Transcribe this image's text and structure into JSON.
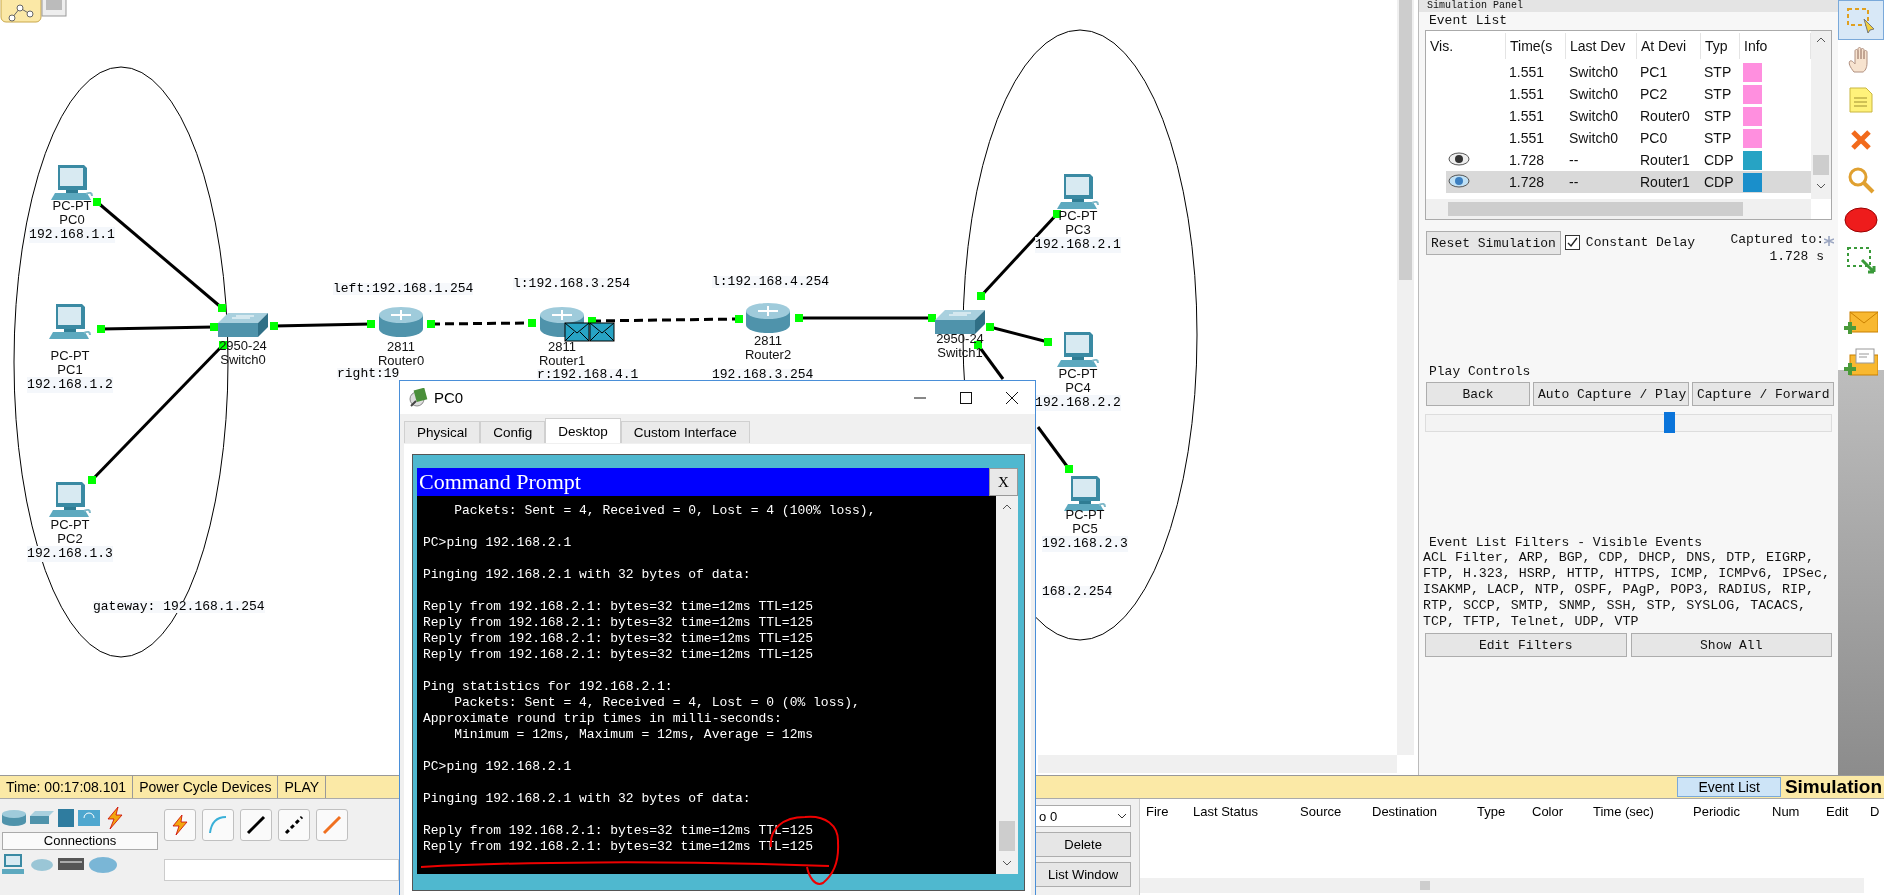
{
  "canvas": {
    "devices": [
      {
        "kind": "pc",
        "model": "PC-PT",
        "name": "PC0",
        "ip": "192.168.1.1"
      },
      {
        "kind": "pc",
        "model": "PC-PT",
        "name": "PC1",
        "ip": "192.168.1.2"
      },
      {
        "kind": "pc",
        "model": "PC-PT",
        "name": "PC2",
        "ip": "192.168.1.3"
      },
      {
        "kind": "switch",
        "model": "2950-24",
        "name": "Switch0"
      },
      {
        "kind": "router",
        "model": "2811",
        "name": "Router0"
      },
      {
        "kind": "router",
        "model": "2811",
        "name": "Router1"
      },
      {
        "kind": "router",
        "model": "2811",
        "name": "Router2"
      },
      {
        "kind": "switch",
        "model": "2950-24",
        "name": "Switch1"
      },
      {
        "kind": "pc",
        "model": "PC-PT",
        "name": "PC3",
        "ip": "192.168.2.1"
      },
      {
        "kind": "pc",
        "model": "PC-PT",
        "name": "PC4",
        "ip": "192.168.2.2"
      },
      {
        "kind": "pc",
        "model": "PC-PT",
        "name": "PC5",
        "ip": "192.168.2.3"
      }
    ],
    "notes": [
      "left:192.168.1.254",
      "right:19",
      "l:192.168.3.254",
      "r:192.168.4.1",
      "l:192.168.4.254",
      "192.168.3.254",
      "168.2.254",
      "gateway: 192.168.1.254"
    ]
  },
  "simulation_panel": {
    "title": "Simulation Panel",
    "event_list": {
      "label": "Event List",
      "columns": [
        "Vis.",
        "Time(s",
        "Last Dev",
        "At Devi",
        "Typ",
        "Info"
      ],
      "rows": [
        {
          "visible": false,
          "selected": false,
          "time": "1.551",
          "last_device": "Switch0",
          "at_device": "PC1",
          "type": "STP",
          "color": "#ff8fdf"
        },
        {
          "visible": false,
          "selected": false,
          "time": "1.551",
          "last_device": "Switch0",
          "at_device": "PC2",
          "type": "STP",
          "color": "#ff8fdf"
        },
        {
          "visible": false,
          "selected": false,
          "time": "1.551",
          "last_device": "Switch0",
          "at_device": "Router0",
          "type": "STP",
          "color": "#ff8fdf"
        },
        {
          "visible": false,
          "selected": false,
          "time": "1.551",
          "last_device": "Switch0",
          "at_device": "PC0",
          "type": "STP",
          "color": "#ff8fdf"
        },
        {
          "visible": true,
          "selected": false,
          "time": "1.728",
          "last_device": "--",
          "at_device": "Router1",
          "type": "CDP",
          "color": "#27a3c4"
        },
        {
          "visible": true,
          "selected": true,
          "time": "1.728",
          "last_device": "--",
          "at_device": "Router1",
          "type": "CDP",
          "color": "#1a8fcb"
        }
      ]
    },
    "reset": "Reset Simulation",
    "constant_delay": {
      "label": "Constant Delay",
      "checked": true
    },
    "captured_label": "Captured to:",
    "captured_value": "1.728 s",
    "play_controls": {
      "label": "Play Controls",
      "buttons": [
        "Back",
        "Auto Capture / Play",
        "Capture / Forward"
      ],
      "level": 0.6
    },
    "filters": {
      "label": "Event List Filters - Visible Events",
      "text": "ACL Filter, ARP, BGP, CDP, DHCP, DNS, DTP, EIGRP, FTP, H.323, HSRP, HTTP, HTTPS, ICMP, ICMPv6, IPSec, ISAKMP, LACP, NTP, OSPF, PAgP, POP3, RADIUS, RIP, RTP, SCCP, SMTP, SNMP, SSH, STP, SYSLOG, TACACS, TCP, TFTP, Telnet, UDP, VTP",
      "buttons": [
        "Edit Filters",
        "Show All"
      ]
    }
  },
  "tools": [
    {
      "kind": "select",
      "selected": true
    },
    {
      "kind": "hand",
      "selected": false
    },
    {
      "kind": "note",
      "selected": false
    },
    {
      "kind": "delete",
      "selected": false
    },
    {
      "kind": "inspect",
      "selected": false
    },
    {
      "kind": "ellipse",
      "selected": false
    },
    {
      "kind": "resize",
      "selected": false
    },
    {
      "kind": "simple_pdu",
      "selected": false
    },
    {
      "kind": "complex_pdu",
      "selected": false
    }
  ],
  "status_bar": {
    "time": "Time: 00:17:08.101",
    "power_cycle": "Power Cycle Devices",
    "play": "PLAY",
    "event_list": "Event List",
    "mode": "Simulation"
  },
  "device_tray": {
    "connections_label": "Connections"
  },
  "pdu_panel": {
    "scenario": "o 0",
    "delete": "Delete",
    "list_window": "List Window",
    "columns": [
      "Fire",
      "Last Status",
      "Source",
      "Destination",
      "Type",
      "Color",
      "Time (sec)",
      "Periodic",
      "Num",
      "Edit",
      "D"
    ]
  },
  "pc_window": {
    "title": "PC0",
    "tabs": [
      {
        "label": "Physical",
        "selected": false
      },
      {
        "label": "Config",
        "selected": false
      },
      {
        "label": "Desktop",
        "selected": true
      },
      {
        "label": "Custom Interface",
        "selected": false
      }
    ],
    "command_prompt": {
      "title": "Command Prompt",
      "close": "X",
      "blocks": [
        [
          "    Packets: Sent = 4, Received = 0, Lost = 4 (100% loss),"
        ],
        [
          "PC>ping 192.168.2.1"
        ],
        [
          "Pinging 192.168.2.1 with 32 bytes of data:"
        ],
        [
          "Reply from 192.168.2.1: bytes=32 time=12ms TTL=125",
          "Reply from 192.168.2.1: bytes=32 time=12ms TTL=125",
          "Reply from 192.168.2.1: bytes=32 time=12ms TTL=125",
          "Reply from 192.168.2.1: bytes=32 time=12ms TTL=125"
        ],
        [
          "Ping statistics for 192.168.2.1:",
          "    Packets: Sent = 4, Received = 4, Lost = 0 (0% loss),",
          "Approximate round trip times in milli-seconds:",
          "    Minimum = 12ms, Maximum = 12ms, Average = 12ms"
        ],
        [
          "PC>ping 192.168.2.1"
        ],
        [
          "Pinging 192.168.2.1 with 32 bytes of data:"
        ],
        [
          "Reply from 192.168.2.1: bytes=32 time=12ms TTL=125",
          "Reply from 192.168.2.1: bytes=32 time=12ms TTL=125"
        ]
      ]
    }
  }
}
